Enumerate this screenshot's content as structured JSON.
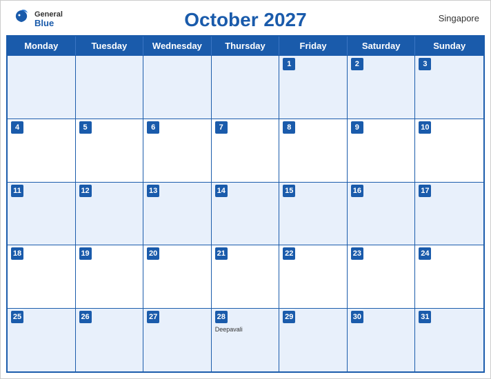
{
  "header": {
    "title": "October 2027",
    "region": "Singapore",
    "logo_general": "General",
    "logo_blue": "Blue"
  },
  "dayHeaders": [
    "Monday",
    "Tuesday",
    "Wednesday",
    "Thursday",
    "Friday",
    "Saturday",
    "Sunday"
  ],
  "weeks": [
    [
      {
        "num": "",
        "events": []
      },
      {
        "num": "",
        "events": []
      },
      {
        "num": "",
        "events": []
      },
      {
        "num": "",
        "events": []
      },
      {
        "num": "1",
        "events": []
      },
      {
        "num": "2",
        "events": []
      },
      {
        "num": "3",
        "events": []
      }
    ],
    [
      {
        "num": "4",
        "events": []
      },
      {
        "num": "5",
        "events": []
      },
      {
        "num": "6",
        "events": []
      },
      {
        "num": "7",
        "events": []
      },
      {
        "num": "8",
        "events": []
      },
      {
        "num": "9",
        "events": []
      },
      {
        "num": "10",
        "events": []
      }
    ],
    [
      {
        "num": "11",
        "events": []
      },
      {
        "num": "12",
        "events": []
      },
      {
        "num": "13",
        "events": []
      },
      {
        "num": "14",
        "events": []
      },
      {
        "num": "15",
        "events": []
      },
      {
        "num": "16",
        "events": []
      },
      {
        "num": "17",
        "events": []
      }
    ],
    [
      {
        "num": "18",
        "events": []
      },
      {
        "num": "19",
        "events": []
      },
      {
        "num": "20",
        "events": []
      },
      {
        "num": "21",
        "events": []
      },
      {
        "num": "22",
        "events": []
      },
      {
        "num": "23",
        "events": []
      },
      {
        "num": "24",
        "events": []
      }
    ],
    [
      {
        "num": "25",
        "events": []
      },
      {
        "num": "26",
        "events": []
      },
      {
        "num": "27",
        "events": []
      },
      {
        "num": "28",
        "events": [
          "Deepavali"
        ]
      },
      {
        "num": "29",
        "events": []
      },
      {
        "num": "30",
        "events": []
      },
      {
        "num": "31",
        "events": []
      }
    ]
  ]
}
